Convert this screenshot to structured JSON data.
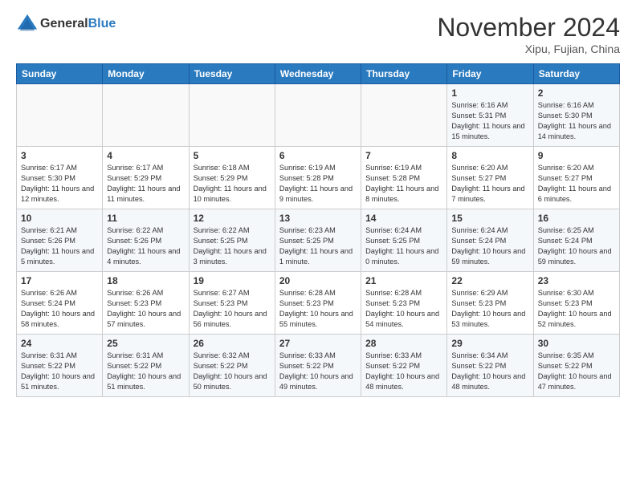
{
  "header": {
    "logo_general": "General",
    "logo_blue": "Blue",
    "month_title": "November 2024",
    "location": "Xipu, Fujian, China"
  },
  "weekdays": [
    "Sunday",
    "Monday",
    "Tuesday",
    "Wednesday",
    "Thursday",
    "Friday",
    "Saturday"
  ],
  "weeks": [
    [
      {
        "day": "",
        "info": ""
      },
      {
        "day": "",
        "info": ""
      },
      {
        "day": "",
        "info": ""
      },
      {
        "day": "",
        "info": ""
      },
      {
        "day": "",
        "info": ""
      },
      {
        "day": "1",
        "info": "Sunrise: 6:16 AM\nSunset: 5:31 PM\nDaylight: 11 hours and 15 minutes."
      },
      {
        "day": "2",
        "info": "Sunrise: 6:16 AM\nSunset: 5:30 PM\nDaylight: 11 hours and 14 minutes."
      }
    ],
    [
      {
        "day": "3",
        "info": "Sunrise: 6:17 AM\nSunset: 5:30 PM\nDaylight: 11 hours and 12 minutes."
      },
      {
        "day": "4",
        "info": "Sunrise: 6:17 AM\nSunset: 5:29 PM\nDaylight: 11 hours and 11 minutes."
      },
      {
        "day": "5",
        "info": "Sunrise: 6:18 AM\nSunset: 5:29 PM\nDaylight: 11 hours and 10 minutes."
      },
      {
        "day": "6",
        "info": "Sunrise: 6:19 AM\nSunset: 5:28 PM\nDaylight: 11 hours and 9 minutes."
      },
      {
        "day": "7",
        "info": "Sunrise: 6:19 AM\nSunset: 5:28 PM\nDaylight: 11 hours and 8 minutes."
      },
      {
        "day": "8",
        "info": "Sunrise: 6:20 AM\nSunset: 5:27 PM\nDaylight: 11 hours and 7 minutes."
      },
      {
        "day": "9",
        "info": "Sunrise: 6:20 AM\nSunset: 5:27 PM\nDaylight: 11 hours and 6 minutes."
      }
    ],
    [
      {
        "day": "10",
        "info": "Sunrise: 6:21 AM\nSunset: 5:26 PM\nDaylight: 11 hours and 5 minutes."
      },
      {
        "day": "11",
        "info": "Sunrise: 6:22 AM\nSunset: 5:26 PM\nDaylight: 11 hours and 4 minutes."
      },
      {
        "day": "12",
        "info": "Sunrise: 6:22 AM\nSunset: 5:25 PM\nDaylight: 11 hours and 3 minutes."
      },
      {
        "day": "13",
        "info": "Sunrise: 6:23 AM\nSunset: 5:25 PM\nDaylight: 11 hours and 1 minute."
      },
      {
        "day": "14",
        "info": "Sunrise: 6:24 AM\nSunset: 5:25 PM\nDaylight: 11 hours and 0 minutes."
      },
      {
        "day": "15",
        "info": "Sunrise: 6:24 AM\nSunset: 5:24 PM\nDaylight: 10 hours and 59 minutes."
      },
      {
        "day": "16",
        "info": "Sunrise: 6:25 AM\nSunset: 5:24 PM\nDaylight: 10 hours and 59 minutes."
      }
    ],
    [
      {
        "day": "17",
        "info": "Sunrise: 6:26 AM\nSunset: 5:24 PM\nDaylight: 10 hours and 58 minutes."
      },
      {
        "day": "18",
        "info": "Sunrise: 6:26 AM\nSunset: 5:23 PM\nDaylight: 10 hours and 57 minutes."
      },
      {
        "day": "19",
        "info": "Sunrise: 6:27 AM\nSunset: 5:23 PM\nDaylight: 10 hours and 56 minutes."
      },
      {
        "day": "20",
        "info": "Sunrise: 6:28 AM\nSunset: 5:23 PM\nDaylight: 10 hours and 55 minutes."
      },
      {
        "day": "21",
        "info": "Sunrise: 6:28 AM\nSunset: 5:23 PM\nDaylight: 10 hours and 54 minutes."
      },
      {
        "day": "22",
        "info": "Sunrise: 6:29 AM\nSunset: 5:23 PM\nDaylight: 10 hours and 53 minutes."
      },
      {
        "day": "23",
        "info": "Sunrise: 6:30 AM\nSunset: 5:23 PM\nDaylight: 10 hours and 52 minutes."
      }
    ],
    [
      {
        "day": "24",
        "info": "Sunrise: 6:31 AM\nSunset: 5:22 PM\nDaylight: 10 hours and 51 minutes."
      },
      {
        "day": "25",
        "info": "Sunrise: 6:31 AM\nSunset: 5:22 PM\nDaylight: 10 hours and 51 minutes."
      },
      {
        "day": "26",
        "info": "Sunrise: 6:32 AM\nSunset: 5:22 PM\nDaylight: 10 hours and 50 minutes."
      },
      {
        "day": "27",
        "info": "Sunrise: 6:33 AM\nSunset: 5:22 PM\nDaylight: 10 hours and 49 minutes."
      },
      {
        "day": "28",
        "info": "Sunrise: 6:33 AM\nSunset: 5:22 PM\nDaylight: 10 hours and 48 minutes."
      },
      {
        "day": "29",
        "info": "Sunrise: 6:34 AM\nSunset: 5:22 PM\nDaylight: 10 hours and 48 minutes."
      },
      {
        "day": "30",
        "info": "Sunrise: 6:35 AM\nSunset: 5:22 PM\nDaylight: 10 hours and 47 minutes."
      }
    ]
  ]
}
